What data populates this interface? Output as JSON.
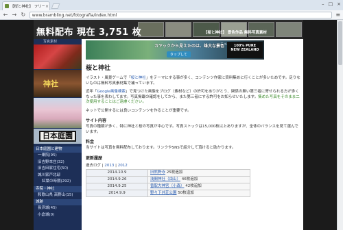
{
  "browser": {
    "tab_title": "【桜と神社】 フリー写真素材",
    "url": "www.brambling.net/fotografia/index.html",
    "window_buttons": [
      "–",
      "□",
      "×"
    ]
  },
  "banner": {
    "title": "無料配布 現在 3,751 枚",
    "subtitle": "【桜と神社】 景色作品 無料写真素材"
  },
  "sidebar": {
    "top_label": "写真素材",
    "shrine_text": "神社",
    "japan_text": "日本庭園",
    "groups": [
      {
        "heading": "日本庭園と建物",
        "items": [
          {
            "label": "一乗院(95)",
            "sub": false
          },
          {
            "label": "旧吉野本庄(32)",
            "sub": false
          },
          {
            "label": "旧吉田家住宅(50)",
            "sub": false
          },
          {
            "label": "城川家戸北邸",
            "sub": false
          },
          {
            "label": "紅葉の時期(292)",
            "sub": true
          }
        ]
      },
      {
        "heading": "寺院・神社",
        "items": [
          {
            "label": "和歌山県 高野山(15)",
            "sub": false
          }
        ]
      },
      {
        "heading": "城跡",
        "items": [
          {
            "label": "長浜城(45)",
            "sub": false
          },
          {
            "label": "小倉城(0)",
            "sub": false
          }
        ]
      }
    ]
  },
  "ad": {
    "text": "カヤックから見えたのは、雄大な景色",
    "button": "タップして",
    "flag": "ニュージーランド",
    "logo_line1": "100% PURE",
    "logo_line2": "NEW ZEALAND"
  },
  "main": {
    "title": "桜と神社",
    "intro_before": "イラスト・風景ゲームで「",
    "intro_link": "桜と神社",
    "intro_after": "」をテーマにする事が多く、コンテンツ作家に資料集めに行くことが多いためです。足りないものは無料写真素材集で補っています。",
    "note_before": "近年「",
    "note_link": "Google画像検索",
    "note_mid": "」で見つけた画像をブログ（素材など）の許可をありがとう、関係の無い第三者に寄せられる方が多くなった事を表わしてます。写真掲載の確認をしてから、また第三者にする許可をお知らせいたします。",
    "note_green": "集めた写真をそのまま二次使用することはご遠慮ください。",
    "note2": "ネットで公開するには良いコンテンツを作ることが重要です。",
    "site_section": "サイト内容",
    "site_desc": "写真の種類が多く、特に神社と桜の写真が中心です。写真ストックは15,000枚以上ありますが、全体のバランスを見て選んでいます。",
    "price_section": "料金",
    "price_desc": "当サイトは写真を無料配布しております。リンクやSNSで紹介して頂けると助かります。",
    "update_section": "更新履歴",
    "update_nav_label": "過去ログ",
    "update_nav_years": [
      "2013",
      "2012"
    ],
    "updates": [
      {
        "date": "2014.10.9",
        "place": "旧熊野寺",
        "count": "25枚追加"
      },
      {
        "date": "2014.9.26",
        "place": "浅間神社（由山）",
        "count": "46枚追加"
      },
      {
        "date": "2014.9.25",
        "place": "香取大神宮（小森）",
        "count": "42枚追加"
      },
      {
        "date": "2014.9.9",
        "place": "野々下井荘公園",
        "count": "50枚追加"
      }
    ]
  }
}
